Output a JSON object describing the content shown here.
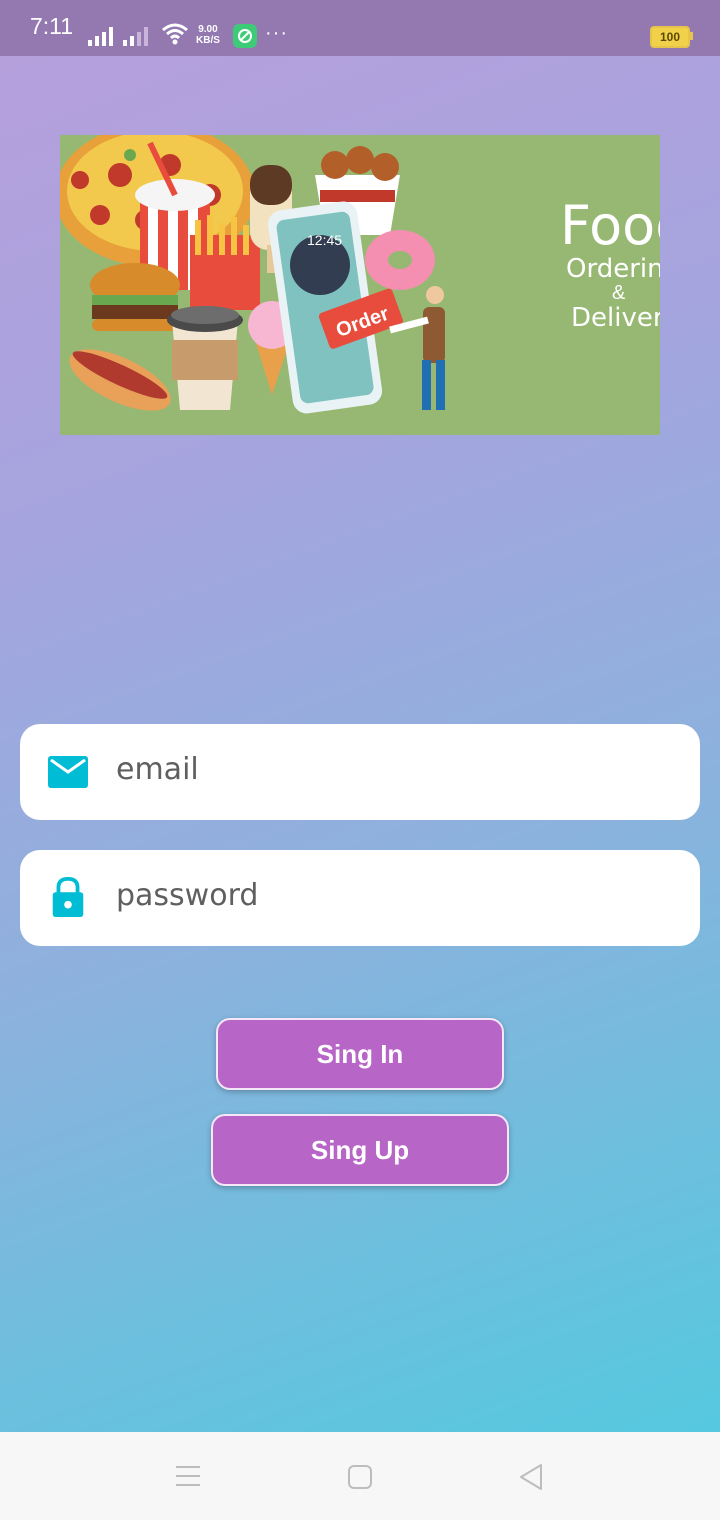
{
  "status_bar": {
    "time": "7:11",
    "speed_value": "9.00",
    "speed_unit": "KB/S",
    "more": "···",
    "battery": "100"
  },
  "banner": {
    "title": "Food",
    "line2": "Ordering",
    "line3": "&",
    "line4": "Delivery",
    "order_sign": "Order",
    "phone_time": "12:45"
  },
  "form": {
    "email_placeholder": "email",
    "password_placeholder": "password"
  },
  "buttons": {
    "sign_in": "Sing In",
    "sign_up": "Sing Up"
  },
  "colors": {
    "accent": "#b865c8",
    "icon": "#00bcd4",
    "banner_bg": "#97b872"
  },
  "icons": [
    "email-icon",
    "lock-icon",
    "menu-icon",
    "home-icon",
    "back-icon"
  ]
}
